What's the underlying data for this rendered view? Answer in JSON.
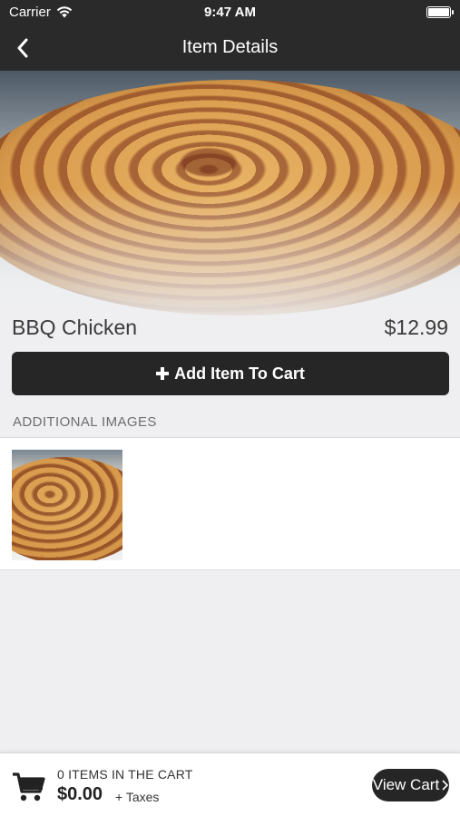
{
  "status_bar": {
    "carrier": "Carrier",
    "time": "9:47 AM"
  },
  "nav": {
    "title": "Item Details",
    "back_icon": "chevron-left-icon"
  },
  "item": {
    "name": "BBQ Chicken",
    "price": "$12.99"
  },
  "add_button": {
    "icon": "plus-icon",
    "label": "Add Item To Cart"
  },
  "additional_images": {
    "header": "ADDITIONAL IMAGES"
  },
  "cart": {
    "count_text": "0 ITEMS IN THE CART",
    "total": "$0.00",
    "taxes": "+ Taxes",
    "view_cart_label": "View Cart",
    "cart_icon": "shopping-cart-icon"
  },
  "colors": {
    "bar_dark": "#2a2a2a",
    "button_dark": "#262626",
    "background": "#efeff1"
  }
}
